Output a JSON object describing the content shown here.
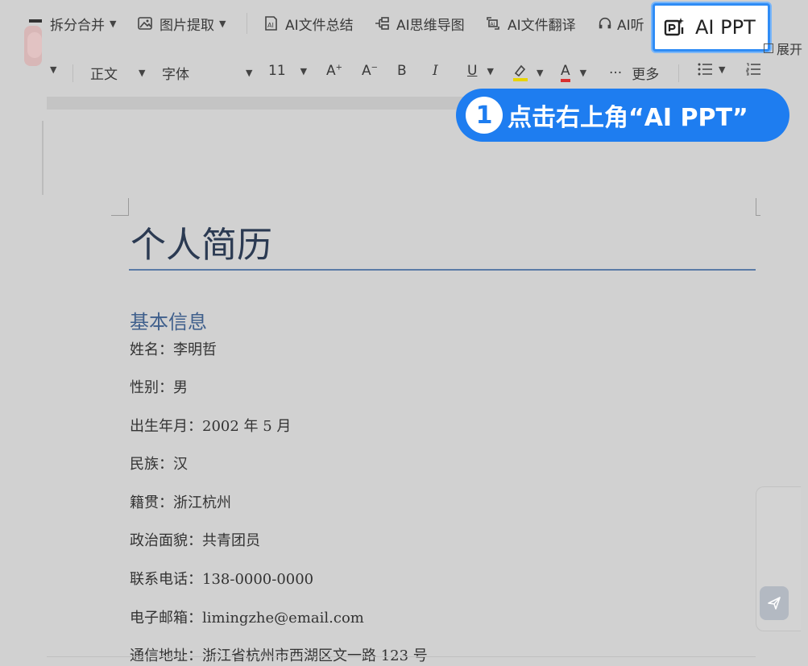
{
  "toolbar": {
    "split_merge": "拆分合并",
    "image_extract": "图片提取",
    "ai_summary": "AI文件总结",
    "ai_mindmap": "AI思维导图",
    "ai_translate": "AI文件翻译",
    "ai_listen": "AI听",
    "ai_ppt": "AI PPT",
    "expand": "展开"
  },
  "format_bar": {
    "style": "正文",
    "font": "字体",
    "font_size": "11",
    "more": "更多",
    "bold": "B",
    "italic": "I",
    "underline": "U",
    "font_color": "A"
  },
  "callout": {
    "step": "1",
    "text": "点击右上角“AI PPT”"
  },
  "document": {
    "title": "个人简历",
    "section": "基本信息",
    "lines": [
      "姓名：李明哲",
      "性别：男",
      "出生年月：2002 年 5 月",
      "民族：汉",
      "籍贯：浙江杭州",
      "政治面貌：共青团员",
      "联系电话：138-0000-0000",
      "电子邮箱：limingzhe@email.com",
      "通信地址：浙江省杭州市西湖区文一路 123 号"
    ]
  },
  "colors": {
    "accent": "#1e7df0",
    "highlight_border": "#2f8cf5",
    "heading": "#3f5f8c",
    "highlight_swatch": "#e8d400",
    "font_color_swatch": "#d93030"
  }
}
